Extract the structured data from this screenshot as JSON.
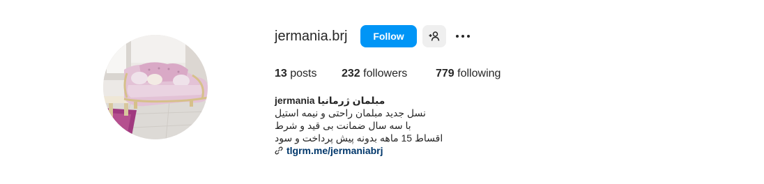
{
  "profile": {
    "username": "jermania.brj",
    "follow_label": "Follow",
    "suggest_icon": "person-add-icon",
    "more_icon": "more-horizontal-icon"
  },
  "stats": {
    "posts": {
      "count": "13",
      "label": "posts"
    },
    "followers": {
      "count": "232",
      "label": "followers"
    },
    "following": {
      "count": "779",
      "label": "following"
    }
  },
  "bio": {
    "name": "jermania مبلمان ژرمانیا",
    "lines": [
      "نسل جدید مبلمان راحتی و نیمه استیل",
      "با سه سال ضمانت بی قید و شرط",
      "اقساط 15 ماهه بدونه پیش پرداخت و سود"
    ],
    "link": "tlgrm.me/jermaniabrj",
    "link_icon": "link-icon"
  },
  "colors": {
    "accent": "#0095f6",
    "text": "#262626",
    "link": "#00376b",
    "secondary_button": "#efefef"
  }
}
